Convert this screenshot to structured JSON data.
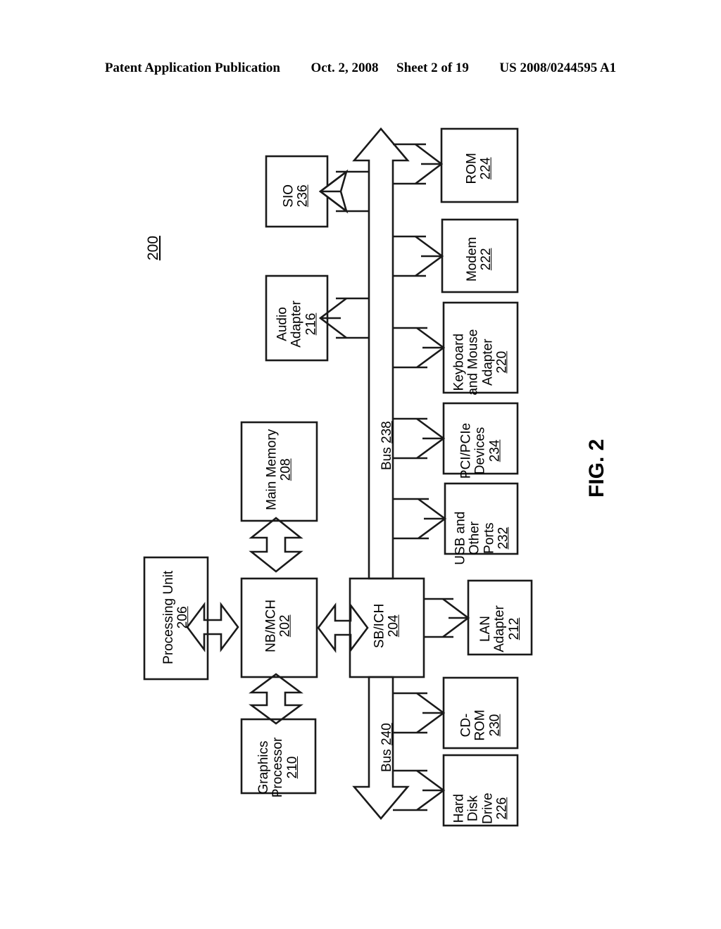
{
  "header": {
    "publication": "Patent Application Publication",
    "date": "Oct. 2, 2008",
    "sheet": "Sheet 2 of 19",
    "patent_number": "US 2008/0244595 A1"
  },
  "figure": {
    "caption": "FIG. 2",
    "system_reference": "200",
    "stroke_color": "#1a1a1a"
  },
  "buses": [
    {
      "id": "bus-238",
      "label": "Bus",
      "number": "238"
    },
    {
      "id": "bus-240",
      "label": "Bus",
      "number": "240"
    }
  ],
  "blocks": [
    {
      "id": "sio",
      "lines": [
        "SIO"
      ],
      "number": "236"
    },
    {
      "id": "audio-adapter",
      "lines": [
        "Audio",
        "Adapter"
      ],
      "number": "216"
    },
    {
      "id": "main-memory",
      "lines": [
        "Main Memory"
      ],
      "number": "208"
    },
    {
      "id": "processing-unit",
      "lines": [
        "Processing Unit"
      ],
      "number": "206"
    },
    {
      "id": "nb-mch",
      "lines": [
        "NB/MCH"
      ],
      "number": "202"
    },
    {
      "id": "graphics-processor",
      "lines": [
        "Graphics",
        "Processor"
      ],
      "number": "210"
    },
    {
      "id": "sb-ich",
      "lines": [
        "SB/ICH"
      ],
      "number": "204"
    },
    {
      "id": "rom",
      "lines": [
        "ROM"
      ],
      "number": "224"
    },
    {
      "id": "modem",
      "lines": [
        "Modem"
      ],
      "number": "222"
    },
    {
      "id": "keyboard-mouse-adapter",
      "lines": [
        "Keyboard",
        "and Mouse",
        "Adapter"
      ],
      "number": "220"
    },
    {
      "id": "pci-pcie-devices",
      "lines": [
        "PCI/PCIe",
        "Devices"
      ],
      "number": "234"
    },
    {
      "id": "usb-other-ports",
      "lines": [
        "USB and",
        "Other",
        "Ports"
      ],
      "number": "232"
    },
    {
      "id": "lan-adapter",
      "lines": [
        "LAN",
        "Adapter"
      ],
      "number": "212"
    },
    {
      "id": "cd-rom",
      "lines": [
        "CD-",
        "ROM"
      ],
      "number": "230"
    },
    {
      "id": "hard-disk-drive",
      "lines": [
        "Hard",
        "Disk",
        "Drive"
      ],
      "number": "226"
    }
  ]
}
